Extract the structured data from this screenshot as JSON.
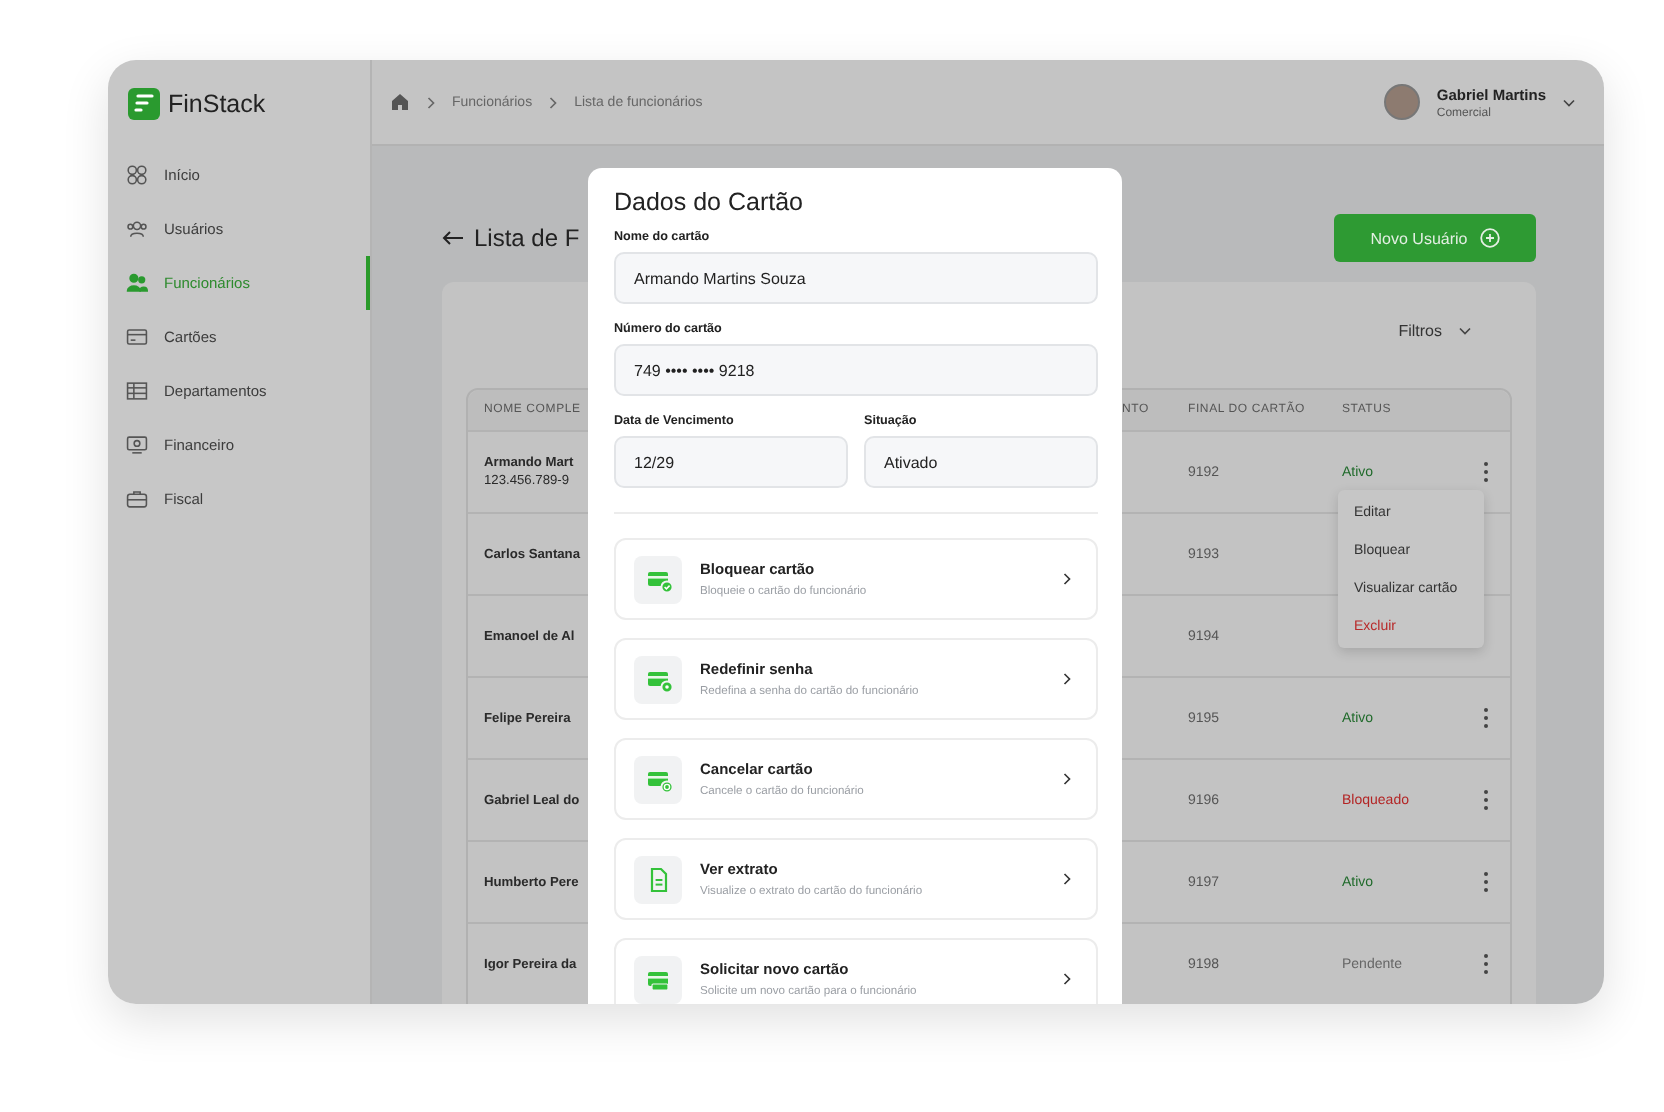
{
  "sidebar": {
    "brand": "FinStack",
    "items": [
      {
        "label": "Início",
        "kind": "grid",
        "selected": false
      },
      {
        "label": "Usuários",
        "kind": "users",
        "selected": false
      },
      {
        "label": "Funcionários",
        "kind": "people",
        "selected": true
      },
      {
        "label": "Cartões",
        "kind": "card",
        "selected": false
      },
      {
        "label": "Departamentos",
        "kind": "table",
        "selected": false
      },
      {
        "label": "Financeiro",
        "kind": "money",
        "selected": false
      },
      {
        "label": "Fiscal",
        "kind": "briefcase",
        "selected": false
      }
    ]
  },
  "topbar": {
    "breadcrumb": [
      "Funcionários",
      "Lista de funcionários"
    ],
    "user": {
      "name": "Gabriel Martins",
      "role": "Comercial"
    }
  },
  "page": {
    "title": "Lista de F",
    "new_button": "Novo Usuário",
    "filters": "Filtros"
  },
  "table": {
    "columns": [
      "NOME COMPLE",
      "NTO",
      "FINAL DO CARTÃO",
      "STATUS"
    ],
    "rows": [
      {
        "name": "Armando Mart",
        "document": "123.456.789-9",
        "card_final": "9192",
        "status": "Ativo",
        "color": "#1f6a2a",
        "menu_button": true
      },
      {
        "name": "Carlos Santana",
        "card_final": "9193",
        "menu_button": false
      },
      {
        "name": "Emanoel de Al",
        "card_final": "9194",
        "menu_button": false
      },
      {
        "name": "Felipe Pereira",
        "card_final": "9195",
        "status": "Ativo",
        "color": "#1f6a2a",
        "menu_button": true
      },
      {
        "name": "Gabriel Leal do",
        "card_final": "9196",
        "status": "Bloqueado",
        "color": "#b32424",
        "menu_button": true
      },
      {
        "name": "Humberto Pere",
        "card_final": "9197",
        "status": "Ativo",
        "color": "#1f6a2a",
        "menu_button": true
      },
      {
        "name": "Igor Pereira da",
        "card_final": "9198",
        "status": "Pendente",
        "color": "#666666",
        "menu_button": true
      }
    ]
  },
  "row_menu": {
    "items": [
      {
        "label": "Editar",
        "kind": "normal"
      },
      {
        "label": "Bloquear",
        "kind": "normal"
      },
      {
        "label": "Visualizar cartão",
        "kind": "normal"
      },
      {
        "label": "Excluir",
        "kind": "danger"
      }
    ]
  },
  "modal": {
    "title": "Dados do Cartão",
    "fields": [
      {
        "label": "Nome do cartão",
        "value": "Armando Martins Souza"
      },
      {
        "label": "Número do cartão",
        "value": "749 •••• •••• 9218"
      },
      {
        "label": "Data de Vencimento",
        "value": "12/29"
      },
      {
        "label": "Situação",
        "value": "Ativado"
      }
    ],
    "actions": [
      {
        "title": "Bloquear cartão",
        "subtitle": "Bloqueie o cartão do funcionário",
        "kind": "lock"
      },
      {
        "title": "Redefinir senha",
        "subtitle": "Redefina a senha do cartão do funcionário",
        "kind": "reset"
      },
      {
        "title": "Cancelar cartão",
        "subtitle": "Cancele o cartão do funcionário",
        "kind": "cancel"
      },
      {
        "title": "Ver extrato",
        "subtitle": "Visualize o extrato do cartão do funcionário",
        "kind": "statement"
      },
      {
        "title": "Solicitar novo cartão",
        "subtitle": "Solicite um novo cartão para o funcionário",
        "kind": "request"
      }
    ]
  }
}
